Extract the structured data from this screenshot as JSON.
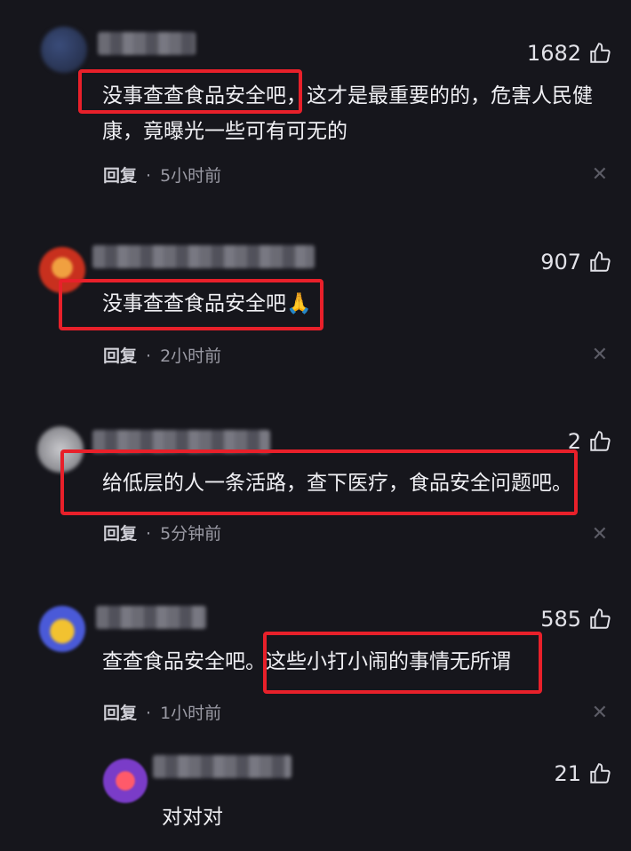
{
  "comments": [
    {
      "likes": "1682",
      "line1": "没事查查食品安全吧，这才是最重要的的，危害人民健",
      "line2": "康，竟曝光一些可有可无的",
      "reply": "回复",
      "time": "5小时前"
    },
    {
      "likes": "907",
      "text": "没事查查食品安全吧🙏",
      "reply": "回复",
      "time": "2小时前"
    },
    {
      "likes": "2",
      "text": "给低层的人一条活路，查下医疗，食品安全问题吧。",
      "reply": "回复",
      "time": "5分钟前"
    },
    {
      "likes": "585",
      "text": "查查食品安全吧。这些小打小闹的事情无所谓",
      "reply": "回复",
      "time": "1小时前"
    },
    {
      "likes": "21",
      "text": "对对对"
    }
  ],
  "icons": {
    "like": "thumbs-up-icon",
    "close": "close-icon"
  },
  "colors": {
    "background": "#16161c",
    "highlight": "#e8202a"
  }
}
